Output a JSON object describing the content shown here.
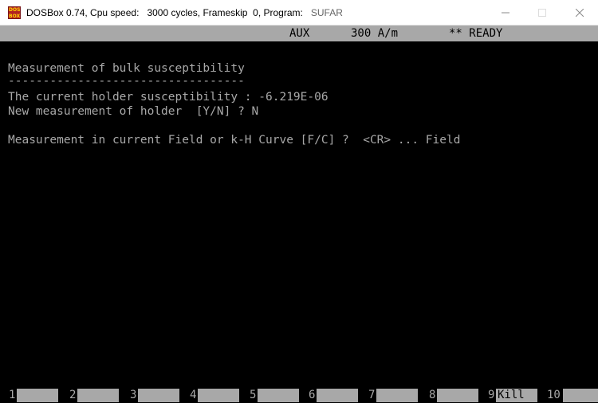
{
  "window": {
    "icon_text": "DOS BOX",
    "title_app": "DOSBox 0.74, Cpu speed:",
    "title_cycles": "3000 cycles, Frameskip  0, Program:",
    "title_program": "SUFAR"
  },
  "status": {
    "mode": "AUX",
    "field": "300 A/m",
    "state": "** READY"
  },
  "terminal": {
    "lines": [
      "Measurement of bulk susceptibility",
      "----------------------------------",
      "The current holder susceptibility : -6.219E-06",
      "New measurement of holder  [Y/N] ? N",
      "Measurement in current Field or k-H Curve [F/C] ?  <CR> ... Field"
    ]
  },
  "function_keys": [
    {
      "num": "1",
      "label": ""
    },
    {
      "num": "2",
      "label": ""
    },
    {
      "num": "3",
      "label": ""
    },
    {
      "num": "4",
      "label": ""
    },
    {
      "num": "5",
      "label": ""
    },
    {
      "num": "6",
      "label": ""
    },
    {
      "num": "7",
      "label": ""
    },
    {
      "num": "8",
      "label": ""
    },
    {
      "num": "9",
      "label": "Kill"
    },
    {
      "num": "10",
      "label": ""
    }
  ]
}
